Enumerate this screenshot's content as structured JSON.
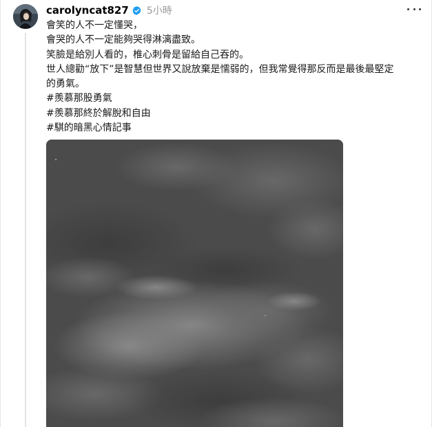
{
  "post": {
    "username": "carolyncat827",
    "timestamp": "5小時",
    "lines": [
      "會笑的人不一定懂哭，",
      "會哭的人不一定能夠哭得淋漓盡致。",
      "笑臉是給別人看的，椎心刺骨是留給自己吞的。",
      "世人總勸“放下”是智慧但世界又說放棄是懦弱的，但我常覺得那反而是最後最堅定",
      "的勇氣。"
    ],
    "hashtags": [
      "#羨慕那股勇氣",
      "#羨慕那終於解脫和自由",
      "#騏的暗黑心情記事"
    ]
  },
  "icons": {
    "verified": "verified-badge-icon",
    "more": "more-options-icon"
  },
  "colors": {
    "verified_badge": "#1d9bf0",
    "timestamp": "#999999",
    "sky_photo_base": "#4a4a4a"
  }
}
